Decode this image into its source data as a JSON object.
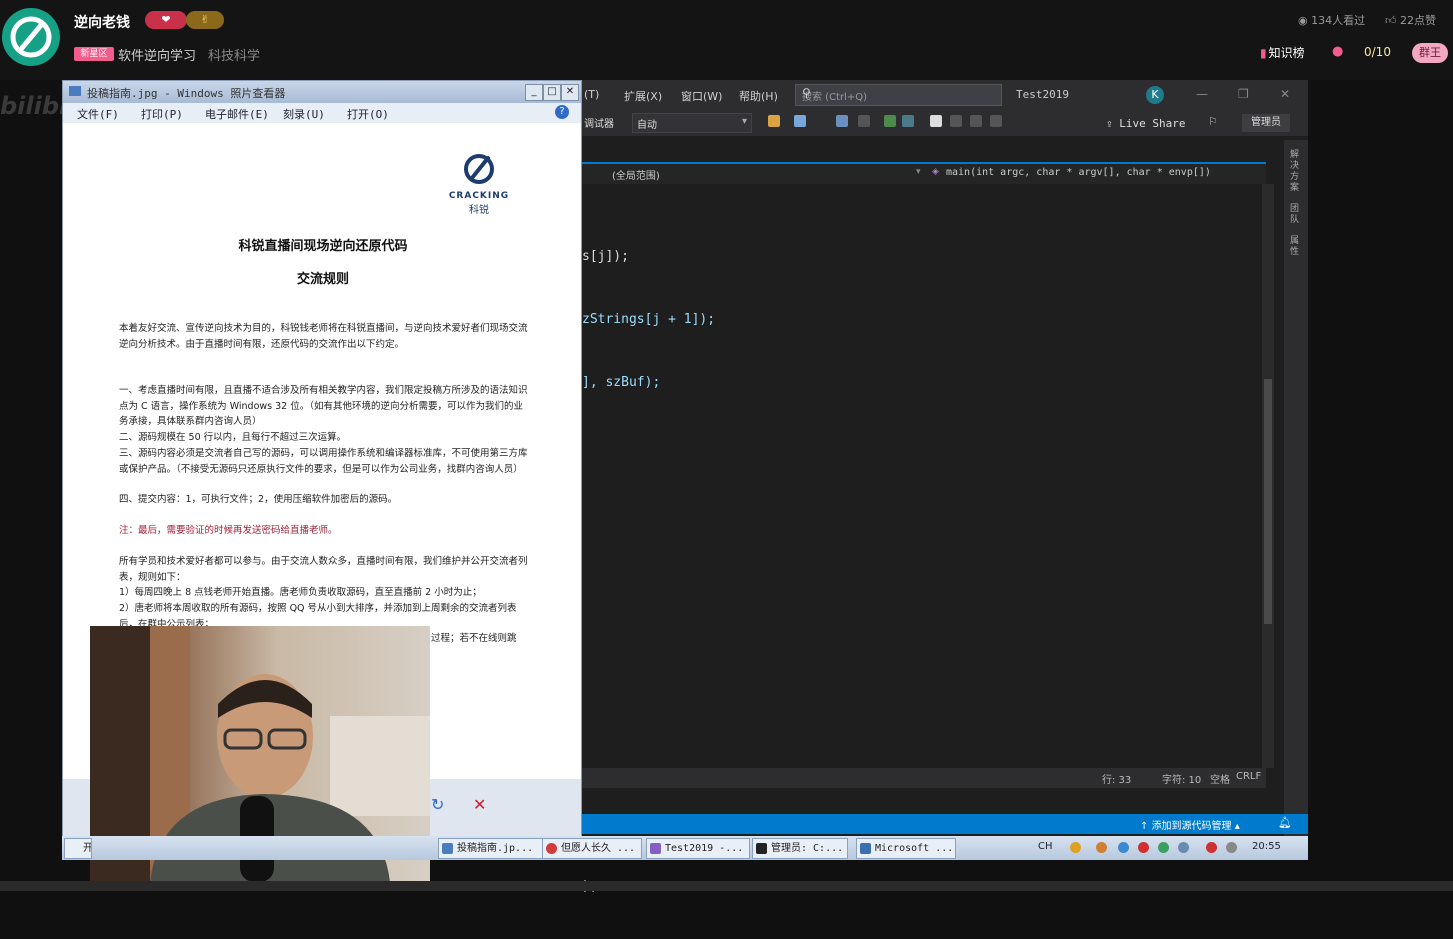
{
  "stream": {
    "streamer": "逆向老钱",
    "heart_badge": "❤",
    "medal_badge": "✌",
    "area_tag": "新星区",
    "sub_area": "软件逆向学习",
    "parent_area": "科技科学",
    "viewers": "134人看过",
    "likes": "22点赞",
    "rank_label": "知识榜",
    "gift_count": "0/10",
    "king_badge": "群王",
    "watermark": "bilibili"
  },
  "vs": {
    "menu": [
      "(T)",
      "扩展(X)",
      "窗口(W)",
      "帮助(H)"
    ],
    "search_placeholder": "搜索 (Ctrl+Q)",
    "solution": "Test2019",
    "avatar": "K",
    "debugger_label": "调试器",
    "combo_value": "自动",
    "live_share": "Live Share",
    "admin_button": "管理员",
    "nav_scope": "(全局范围)",
    "nav_function": "main(int argc, char * argv[], char * envp[])",
    "code_lines": [
      "s[j]);",
      "zStrings[j + 1]);",
      "], szBuf);",
      "",
      "",
      "",
      "",
      "",
      "",
      "",
      ");"
    ],
    "side_tabs": [
      "解决方案",
      "团队",
      "属性"
    ],
    "status_row": "行: 33",
    "status_col": "字符: 10",
    "status_space": "空格",
    "status_crlf": "CRLF",
    "source_control": "添加到源代码管理"
  },
  "viewer": {
    "title": "投稿指南.jpg - Windows 照片查看器",
    "menu": [
      "文件(F)",
      "打印(P)",
      "电子邮件(E)",
      "刻录(U)",
      "打开(O)"
    ],
    "help": "?",
    "doc": {
      "logo_text": "CRACKING",
      "logo_cn": "科锐",
      "title": "科锐直播间现场逆向还原代码",
      "subtitle": "交流规则",
      "intro": "本着友好交流、宣传逆向技术为目的，科锐钱老师将在科锐直播间，与逆向技术爱好者们现场交流逆向分析技术。由于直播时间有限，还原代码的交流作出以下约定。",
      "rule1": "一、考虑直播时间有限，且直播不适合涉及所有相关教学内容，我们限定投稿方所涉及的语法知识点为 C 语言，操作系统为 Windows 32 位。（如有其他环境的逆向分析需要，可以作为我们的业务承接，具体联系群内咨询人员）",
      "rule2": "二、源码规模在 50 行以内，且每行不超过三次运算。",
      "rule3": "三、源码内容必须是交流者自己写的源码，可以调用操作系统和编译器标准库，不可使用第三方库或保护产品。（不接受无源码只还原执行文件的要求，但是可以作为公司业务，找群内咨询人员）",
      "rule4": "四、提交内容：1，可执行文件；2，使用压缩软件加密后的源码。",
      "note": "注：最后，需要验证的时候再发送密码给直播老师。",
      "para2": "所有学员和技术爱好者都可以参与。由于交流人数众多，直播时间有限，我们维护并公开交流者列表，规则如下：",
      "item1": "1）每周四晚上 8 点钱老师开始直播。唐老师负责收取源码，直至直播前 2 小时为止；",
      "item2": "2）唐老师将本周收取的所有源码，按照 QQ 号从小到大排序，并添加到上周剩余的交流者列表后，在群中公示列表；",
      "item3": "过程；若不在线则跳"
    }
  },
  "taskbar": {
    "start": "开",
    "items": [
      "投稿指南.jp...",
      "但愿人长久 ...",
      "Test2019 -...",
      "管理员: C:...",
      "Microsoft ..."
    ],
    "ime": "CH",
    "clock": "20:55"
  }
}
